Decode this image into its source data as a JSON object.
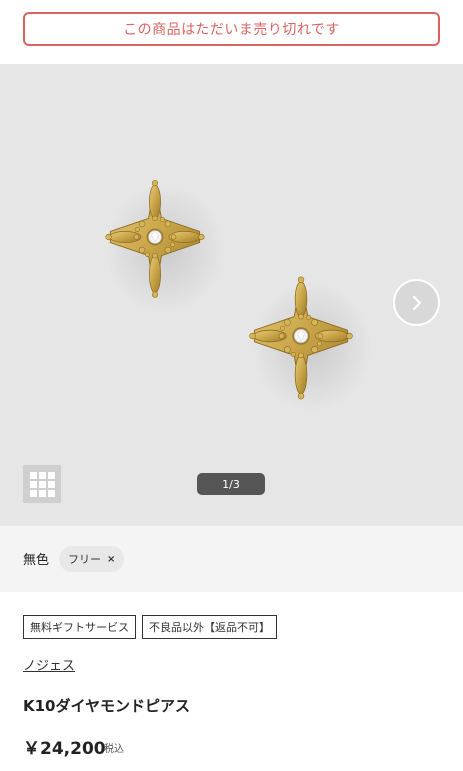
{
  "notice": {
    "sold_out_text": "この商品はただいま売り切れです"
  },
  "gallery": {
    "pager_text": "1/3",
    "next_icon": "chevron-right-icon",
    "grid_icon": "grid-icon"
  },
  "variant": {
    "color_label": "無色",
    "size_chip_label": "フリー",
    "size_chip_remove": "×"
  },
  "tags": [
    "無料ギフトサービス",
    "不良品以外【返品不可】"
  ],
  "product": {
    "brand": "ノジェス",
    "name": "K10ダイヤモンドピアス",
    "price": "￥24,200",
    "tax_label": "税込"
  },
  "colors": {
    "accent_red": "#d9645f",
    "gold": "#c9a548",
    "gallery_bg": "#e6e6e6"
  }
}
